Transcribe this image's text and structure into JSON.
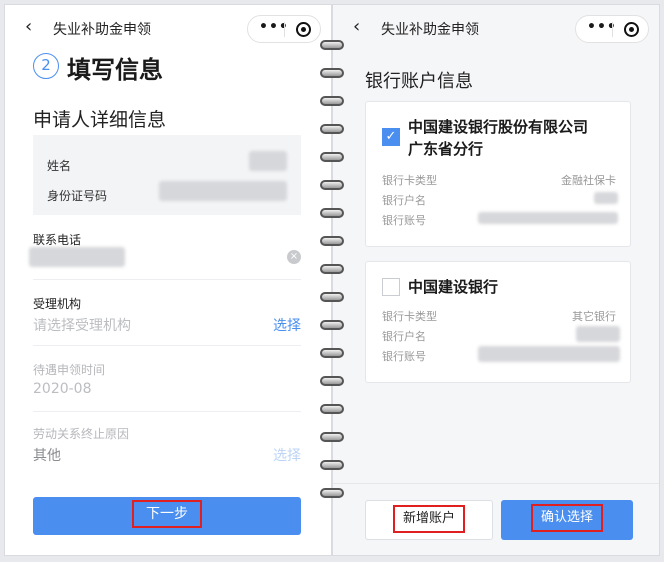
{
  "app": {
    "title": "失业补助金申领",
    "back_icon": "‹",
    "more_icon": "•••"
  },
  "left": {
    "step_number": "2",
    "step_title": "填写信息",
    "section_title": "申请人详细信息",
    "name_label": "姓名",
    "id_label": "身份证号码",
    "phone_label": "联系电话",
    "agency_label": "受理机构",
    "agency_placeholder": "请选择受理机构",
    "agency_select": "选择",
    "benefit_time_label": "待遇申领时间",
    "benefit_time_value": "2020-08",
    "termination_label": "劳动关系终止原因",
    "termination_value": "其他",
    "termination_select": "选择",
    "next_button": "下一步"
  },
  "right": {
    "title": "银行账户信息",
    "accounts": [
      {
        "bank_line1": "中国建设银行股份有限公司",
        "bank_line2": "广东省分行",
        "checked": true,
        "card_type_label": "银行卡类型",
        "card_type_value": "金融社保卡",
        "holder_label": "银行户名",
        "number_label": "银行账号"
      },
      {
        "bank_line1": "中国建设银行",
        "checked": false,
        "card_type_label": "银行卡类型",
        "card_type_value": "其它银行",
        "holder_label": "银行户名",
        "number_label": "银行账号"
      }
    ],
    "add_account_button": "新增账户",
    "confirm_button": "确认选择"
  },
  "colors": {
    "accent": "#4a8ff0",
    "highlight_box": "#e02020",
    "page_bg": "#f5f6f8"
  }
}
